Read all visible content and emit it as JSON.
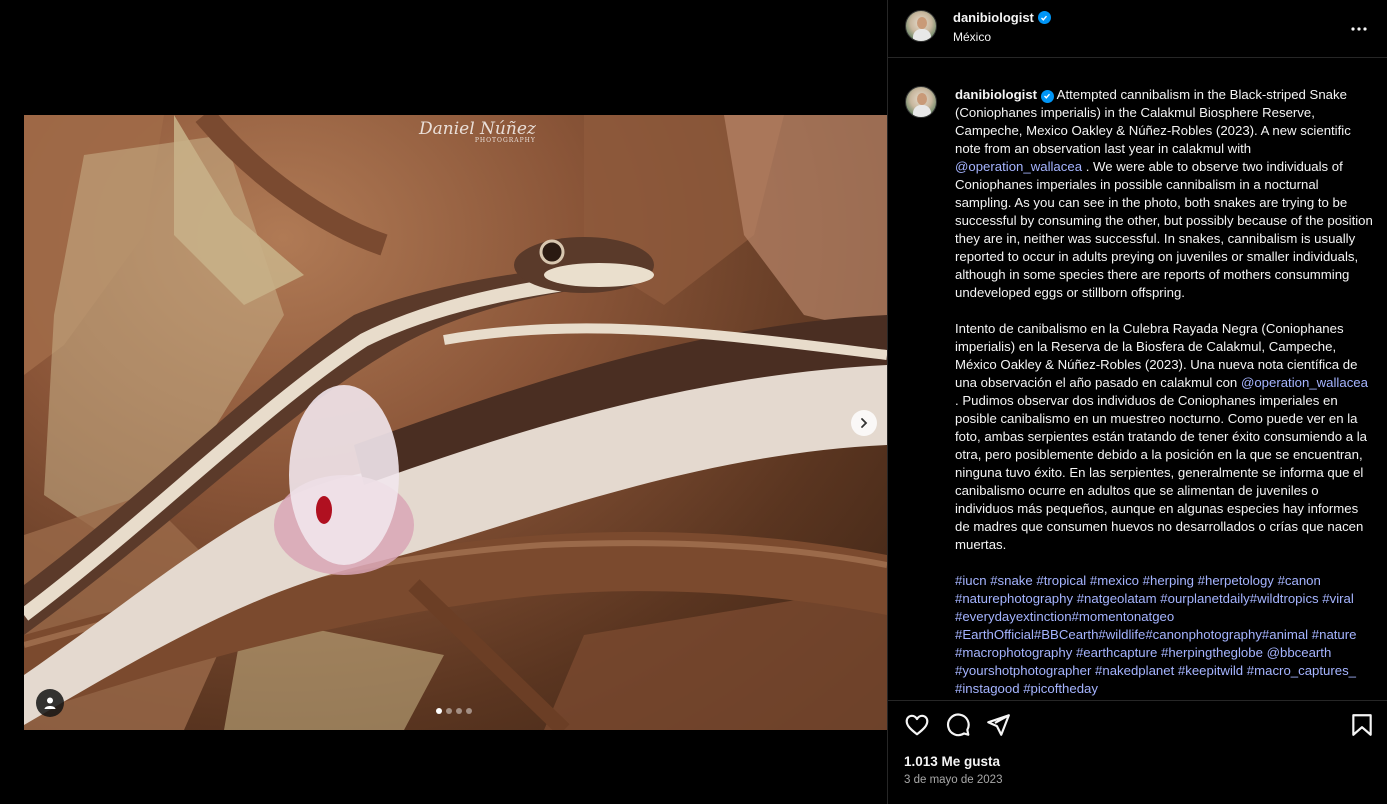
{
  "post": {
    "username": "danibiologist",
    "location": "México",
    "watermark": "Daniel Núñez",
    "watermark_sub": "PHOTOGRAPHY",
    "caption_en": "Attempted cannibalism in the Black-striped Snake (Coniophanes imperialis) in the Calakmul Biosphere Reserve, Campeche, Mexico Oakley & Núñez-Robles (2023). A new scientific note from an observation last year in calakmul with",
    "mention": "@operation_wallacea",
    "caption_en_2": ". We were able to observe two individuals of Coniophanes imperiales in possible cannibalism in a nocturnal sampling. As you can see in the photo, both snakes are trying to be successful by consuming the other, but possibly because of the position they are in, neither was successful. In snakes, cannibalism is usually reported to occur in adults preying on juveniles or smaller individuals, although in some species there are reports of mothers consumming undeveloped eggs or stillborn offspring.",
    "caption_es": "Intento de canibalismo en la Culebra Rayada Negra (Coniophanes imperialis) en la Reserva de la Biosfera de Calakmul, Campeche, México Oakley & Núñez-Robles (2023). Una nueva nota científica de una observación el año pasado en calakmul con",
    "caption_es_2": ". Pudimos observar dos individuos de Coniophanes imperiales en posible canibalismo en un muestreo nocturno. Como puede ver en la foto, ambas serpientes están tratando de tener éxito consumiendo a la otra, pero posiblemente debido a la posición en la que se encuentran, ninguna tuvo éxito. En las serpientes, generalmente se informa que el canibalismo ocurre en adultos que se alimentan de juveniles o individuos más pequeños, aunque en algunas especies hay informes de madres que consumen huevos no desarrollados o crías que nacen muertas.",
    "hashtags": "#iucn #snake #tropical #mexico #herping #herpetology #canon #naturephotography #natgeolatam #ourplanetdaily#wildtropics #viral #everydayextinction#momentonatgeo #EarthOfficial#BBCearth#wildlife#canonphotography#animal #nature #macrophotography #earthcapture #herpingtheglobe @bbcearth #yourshotphotographer #nakedplanet #keepitwild #macro_captures_ #instagood #picoftheday",
    "likes": "1.013 Me gusta",
    "date": "3 de mayo de 2023",
    "carousel_total": 4,
    "carousel_active": 1
  },
  "colors": {
    "background": "#000000",
    "text": "#f5f5f5",
    "link": "#a5b4ff",
    "verified": "#0095f6",
    "muted": "#a8a8a8"
  },
  "icons": [
    "heart-icon",
    "comment-icon",
    "share-icon",
    "bookmark-icon",
    "more-icon",
    "chevron-right-icon",
    "user-tag-icon",
    "verified-icon"
  ]
}
